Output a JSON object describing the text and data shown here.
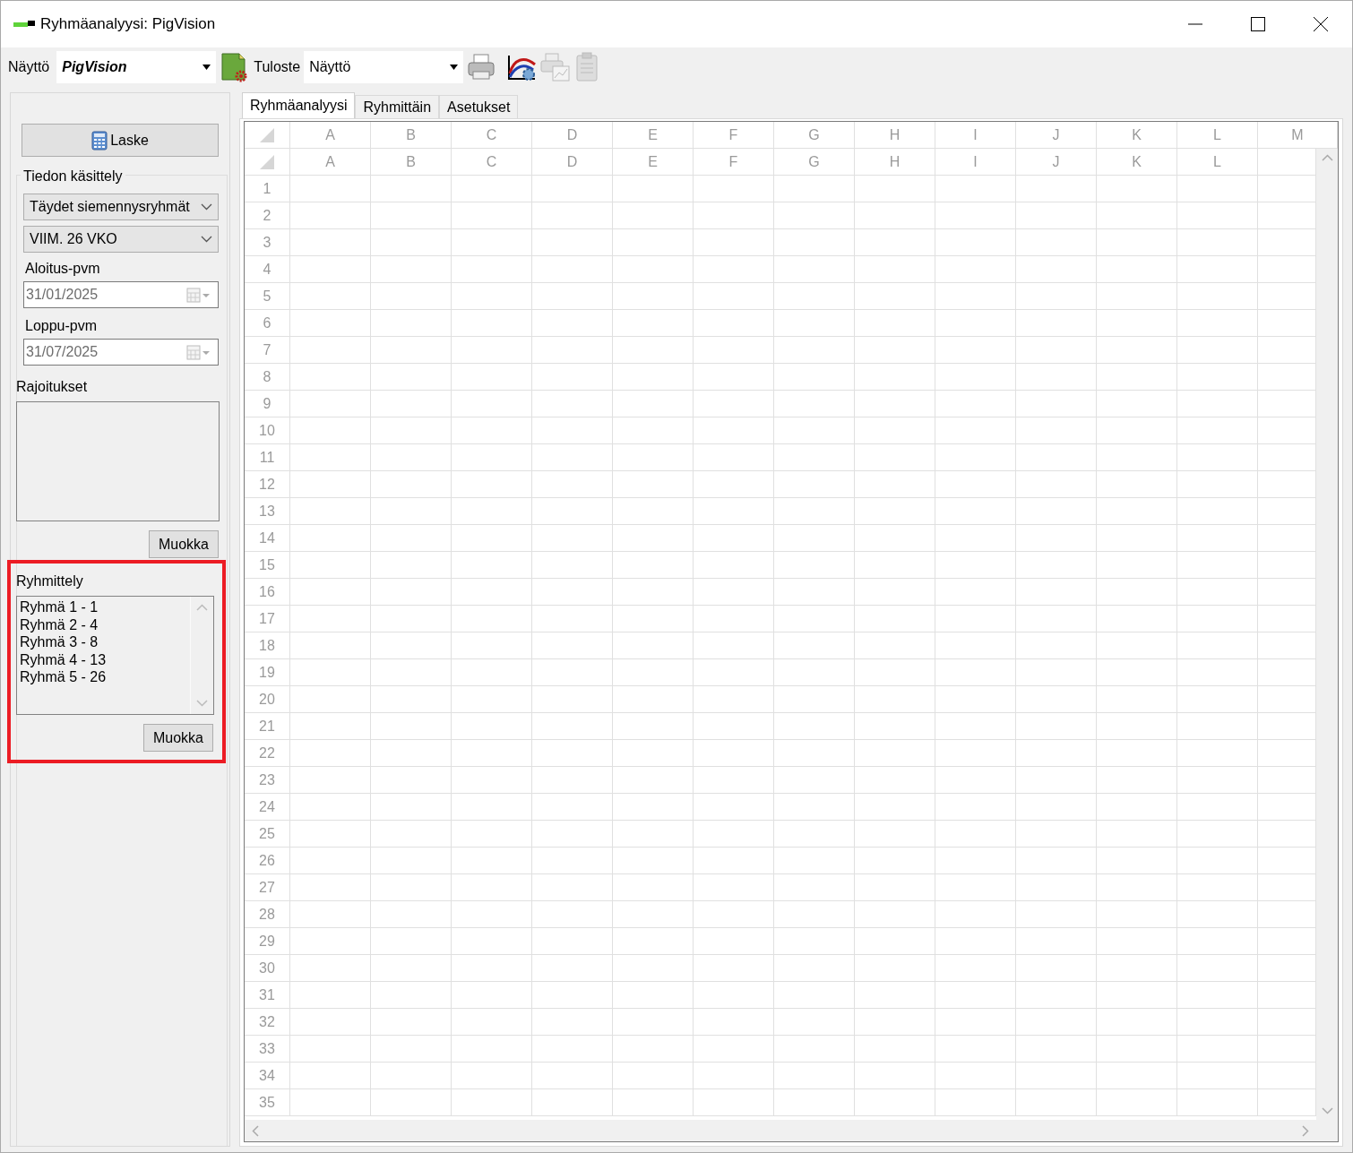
{
  "window": {
    "title": "Ryhmäanalyysi: PigVision"
  },
  "toolbar": {
    "display_label": "Näyttö",
    "display_value": "PigVision",
    "output_label": "Tuloste",
    "output_value": "Näyttö"
  },
  "tabs": [
    {
      "label": "Ryhmäanalyysi",
      "selected": true
    },
    {
      "label": "Ryhmittäin",
      "selected": false
    },
    {
      "label": "Asetukset",
      "selected": false
    }
  ],
  "left_panel": {
    "calculate_button": "Laske",
    "data_group": {
      "title": "Tiedon käsittely",
      "selects": [
        "Täydet siemennysryhmät",
        "VIIM. 26 VKO"
      ],
      "start_label": "Aloitus-pvm",
      "start_date": "31/01/2025",
      "start_disabled": true,
      "end_label": "Loppu-pvm",
      "end_date": "31/07/2025",
      "end_disabled": true
    },
    "restrictions": {
      "title": "Rajoitukset",
      "edit_button": "Muokka"
    },
    "grouping": {
      "title": "Ryhmittely",
      "highlighted": true,
      "items": [
        "Ryhmä 1 - 1",
        "Ryhmä 2 - 4",
        "Ryhmä 3 - 8",
        "Ryhmä 4 - 13",
        "Ryhmä 5 - 26"
      ],
      "edit_button": "Muokka"
    }
  },
  "grid": {
    "columns": [
      "A",
      "B",
      "C",
      "D",
      "E",
      "F",
      "G",
      "H",
      "I",
      "J",
      "K",
      "L",
      "M"
    ],
    "second_header": [
      "A",
      "B",
      "C",
      "D",
      "E",
      "F",
      "G",
      "H",
      "I",
      "J",
      "K",
      "L"
    ],
    "rows": [
      "1",
      "2",
      "3",
      "4",
      "5",
      "6",
      "7",
      "8",
      "9",
      "10",
      "11",
      "12",
      "13",
      "14",
      "15",
      "16",
      "17",
      "18",
      "19",
      "20",
      "21",
      "22",
      "23",
      "24",
      "25",
      "26",
      "27",
      "28",
      "29",
      "30",
      "31",
      "32",
      "33",
      "34",
      "35"
    ]
  }
}
